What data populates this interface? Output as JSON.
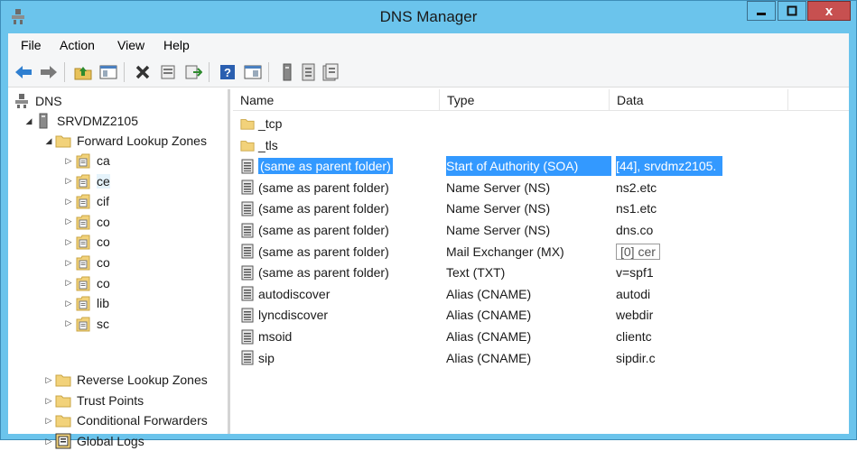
{
  "window": {
    "title": "DNS Manager",
    "close_glyph": "x",
    "accent_color": "#6bc4ec",
    "close_color": "#c75050"
  },
  "menu": [
    "File",
    "Action",
    "View",
    "Help"
  ],
  "toolbar_icons": [
    "back-arrow-icon",
    "forward-arrow-icon",
    "up-folder-icon",
    "show-hide-tree-icon",
    "delete-icon",
    "properties-icon",
    "export-list-icon",
    "help-icon",
    "mmc-window-icon",
    "update-server-data-icon",
    "new-host-icon",
    "new-alias-icon"
  ],
  "tree": {
    "root": "DNS",
    "server": "SRVDMZ2105",
    "forward_zones": "Forward Lookup Zones",
    "zones": [
      "ca",
      "ce",
      "cif",
      "co",
      "co",
      "co",
      "co",
      "lib",
      "sc"
    ],
    "selected_zone_index": 1,
    "reverse_zones": "Reverse Lookup Zones",
    "trust_points": "Trust Points",
    "conditional_forwarders": "Conditional Forwarders",
    "global_logs": "Global Logs"
  },
  "columns": [
    "Name",
    "Type",
    "Data"
  ],
  "rows": [
    {
      "name": "_tcp",
      "type": "",
      "data": "",
      "icon": "folder-icon"
    },
    {
      "name": "_tls",
      "type": "",
      "data": "",
      "icon": "folder-icon"
    },
    {
      "name": "(same as parent folder)",
      "type": "Start of Authority (SOA)",
      "data": "[44], srvdmz2105.",
      "icon": "record-icon"
    },
    {
      "name": "(same as parent folder)",
      "type": "Name Server (NS)",
      "data": "ns2.etc",
      "icon": "record-icon"
    },
    {
      "name": "(same as parent folder)",
      "type": "Name Server (NS)",
      "data": "ns1.etc",
      "icon": "record-icon"
    },
    {
      "name": "(same as parent folder)",
      "type": "Name Server (NS)",
      "data": "dns.co",
      "icon": "record-icon"
    },
    {
      "name": "(same as parent folder)",
      "type": "Mail Exchanger (MX)",
      "data": "[0]  cer",
      "icon": "record-icon"
    },
    {
      "name": "(same as parent folder)",
      "type": "Text (TXT)",
      "data": "v=spf1",
      "icon": "record-icon"
    },
    {
      "name": "autodiscover",
      "type": "Alias (CNAME)",
      "data": "autodi",
      "icon": "record-icon"
    },
    {
      "name": "lyncdiscover",
      "type": "Alias (CNAME)",
      "data": "webdir",
      "icon": "record-icon"
    },
    {
      "name": "msoid",
      "type": "Alias (CNAME)",
      "data": "clientc",
      "icon": "record-icon"
    },
    {
      "name": "sip",
      "type": "Alias (CNAME)",
      "data": "sipdir.c",
      "icon": "record-icon"
    }
  ],
  "selected_row_index": 2,
  "boxed_row_index": 6
}
